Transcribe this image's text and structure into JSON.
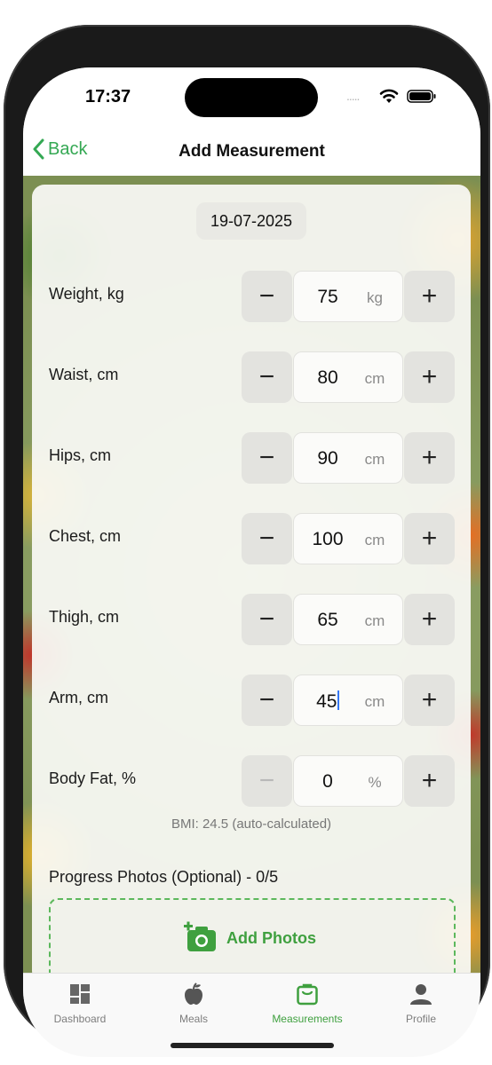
{
  "status_bar": {
    "time": "17:37",
    "signal": "....."
  },
  "nav": {
    "back_label": "Back",
    "title": "Add Measurement"
  },
  "date": "19-07-2025",
  "measurements": [
    {
      "label": "Weight, kg",
      "value": "75",
      "unit": "kg"
    },
    {
      "label": "Waist, cm",
      "value": "80",
      "unit": "cm"
    },
    {
      "label": "Hips, cm",
      "value": "90",
      "unit": "cm"
    },
    {
      "label": "Chest, cm",
      "value": "100",
      "unit": "cm"
    },
    {
      "label": "Thigh, cm",
      "value": "65",
      "unit": "cm"
    },
    {
      "label": "Arm, cm",
      "value": "45",
      "unit": "cm"
    },
    {
      "label": "Body Fat, %",
      "value": "0",
      "unit": "%"
    }
  ],
  "stepper": {
    "minus": "−",
    "plus": "+"
  },
  "bmi_note": "BMI: 24.5 (auto-calculated)",
  "photos": {
    "label": "Progress Photos (Optional) - 0/5",
    "add_label": "Add Photos"
  },
  "tabs": [
    {
      "label": "Dashboard",
      "icon": "dashboard-icon"
    },
    {
      "label": "Meals",
      "icon": "apple-icon"
    },
    {
      "label": "Measurements",
      "icon": "bag-icon",
      "active": true
    },
    {
      "label": "Profile",
      "icon": "person-icon"
    }
  ],
  "colors": {
    "accent": "#3fa03f",
    "caret": "#3478f6"
  }
}
